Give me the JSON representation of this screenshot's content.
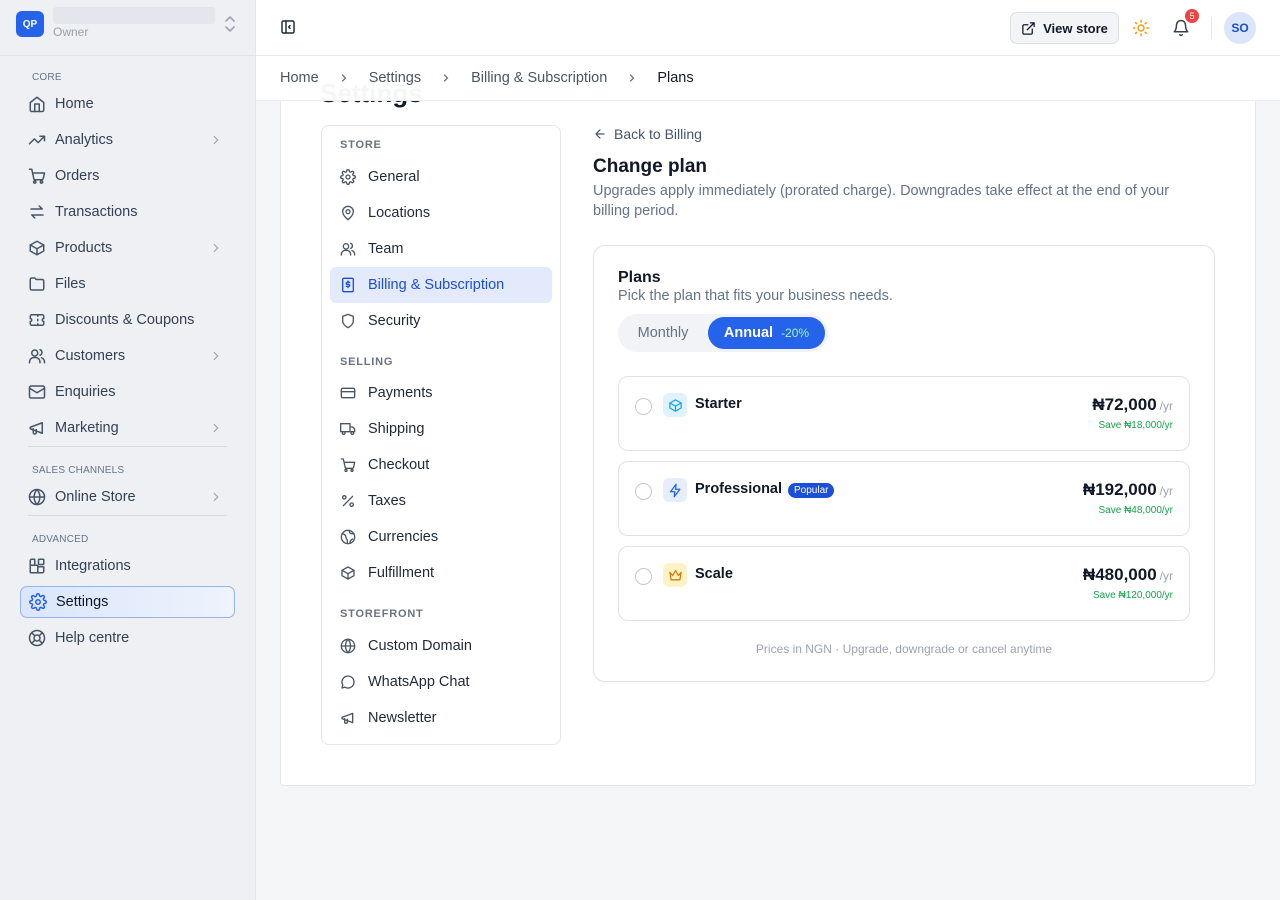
{
  "sidebar": {
    "brand_initials": "QP",
    "brand_role": "Owner",
    "sections": {
      "core": "CORE",
      "sales": "SALES CHANNELS",
      "advanced": "ADVANCED"
    },
    "items": {
      "home": "Home",
      "analytics": "Analytics",
      "orders": "Orders",
      "transactions": "Transactions",
      "products": "Products",
      "files": "Files",
      "discounts": "Discounts & Coupons",
      "customers": "Customers",
      "enquiries": "Enquiries",
      "marketing": "Marketing",
      "online_store": "Online Store",
      "integrations": "Integrations",
      "settings": "Settings",
      "help": "Help centre"
    }
  },
  "topbar": {
    "view_store": "View store",
    "notification_count": "5",
    "avatar_initials": "SO"
  },
  "breadcrumb": [
    "Home",
    "Settings",
    "Billing & Subscription",
    "Plans"
  ],
  "page_heading": "Settings",
  "settings_nav": {
    "sections": {
      "store": "STORE",
      "selling": "SELLING",
      "storefront": "STOREFRONT"
    },
    "items": {
      "general": "General",
      "locations": "Locations",
      "team": "Team",
      "billing": "Billing & Subscription",
      "security": "Security",
      "payments": "Payments",
      "shipping": "Shipping",
      "checkout": "Checkout",
      "taxes": "Taxes",
      "currencies": "Currencies",
      "fulfillment": "Fulfillment",
      "custom_domain": "Custom Domain",
      "whatsapp": "WhatsApp Chat",
      "newsletter": "Newsletter"
    }
  },
  "content": {
    "back_link": "Back to Billing",
    "title": "Change plan",
    "description": "Upgrades apply immediately (prorated charge). Downgrades take effect at the end of your billing period."
  },
  "plans": {
    "title": "Plans",
    "subtitle": "Pick the plan that fits your business needs.",
    "toggle": {
      "monthly": "Monthly",
      "annual": "Annual",
      "discount": "-20%",
      "selected": "annual"
    },
    "items": [
      {
        "name": "Starter",
        "price": "₦72,000",
        "period": "/yr",
        "save": "Save ₦18,000/yr",
        "badge": "",
        "icon": "box-icon",
        "color": "#0ea5e9"
      },
      {
        "name": "Professional",
        "price": "₦192,000",
        "period": "/yr",
        "save": "Save ₦48,000/yr",
        "badge": "Popular",
        "icon": "lightning-icon",
        "color": "#2563eb"
      },
      {
        "name": "Scale",
        "price": "₦480,000",
        "period": "/yr",
        "save": "Save ₦120,000/yr",
        "badge": "",
        "icon": "crown-icon",
        "color": "#d97706"
      }
    ],
    "footer": "Prices in NGN · Upgrade, downgrade or cancel anytime"
  },
  "colors": {
    "accent": "#2563eb",
    "success": "#16a34a",
    "badge": "#ef4444"
  }
}
